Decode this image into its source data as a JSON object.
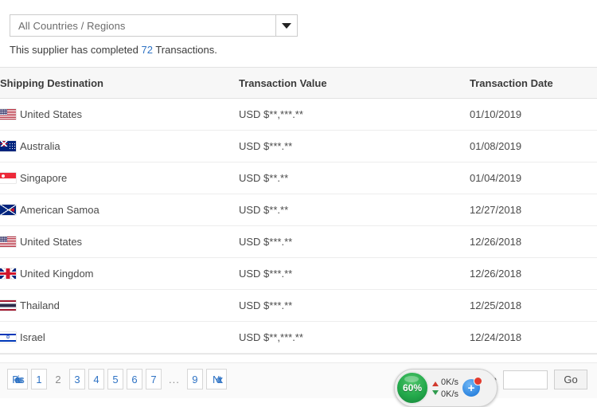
{
  "filter": {
    "selected": "All Countries / Regions",
    "dropdown_icon": "chevron-down-icon"
  },
  "summary": {
    "prefix": "This supplier has completed ",
    "count": "72",
    "suffix": " Transactions."
  },
  "table": {
    "columns": [
      "Shipping Destination",
      "Transaction Value",
      "Transaction Date"
    ],
    "rows": [
      {
        "flag": "us",
        "destination": "United States",
        "value": "USD $**,***.**",
        "date": "01/10/2019"
      },
      {
        "flag": "au",
        "destination": "Australia",
        "value": "USD $***.**",
        "date": "01/08/2019"
      },
      {
        "flag": "sg",
        "destination": "Singapore",
        "value": "USD $**.**",
        "date": "01/04/2019"
      },
      {
        "flag": "as",
        "destination": "American Samoa",
        "value": "USD $**.**",
        "date": "12/27/2018"
      },
      {
        "flag": "us",
        "destination": "United States",
        "value": "USD $***.**",
        "date": "12/26/2018"
      },
      {
        "flag": "gb",
        "destination": "United Kingdom",
        "value": "USD $***.**",
        "date": "12/26/2018"
      },
      {
        "flag": "th",
        "destination": "Thailand",
        "value": "USD $***.**",
        "date": "12/25/2018"
      },
      {
        "flag": "il",
        "destination": "Israel",
        "value": "USD $**,***.**",
        "date": "12/24/2018"
      }
    ]
  },
  "pagination": {
    "previous_label": "Previous",
    "next_label": "Next",
    "pages": [
      "1",
      "2",
      "3",
      "4",
      "5",
      "6",
      "7",
      "...",
      "9"
    ],
    "current_page": "2",
    "goto_label": "Go to Page",
    "goto_value": "",
    "goto_placeholder": "",
    "go_label": "Go",
    "link_color": "#2f73c4"
  },
  "netmon": {
    "gauge_percent": "60%",
    "upload_rate": "0K/s",
    "download_rate": "0K/s",
    "badge_glyph": "+",
    "gauge_color": "#23a94b",
    "badge_color": "#2f86e0",
    "alert_color": "#e23b2e"
  }
}
